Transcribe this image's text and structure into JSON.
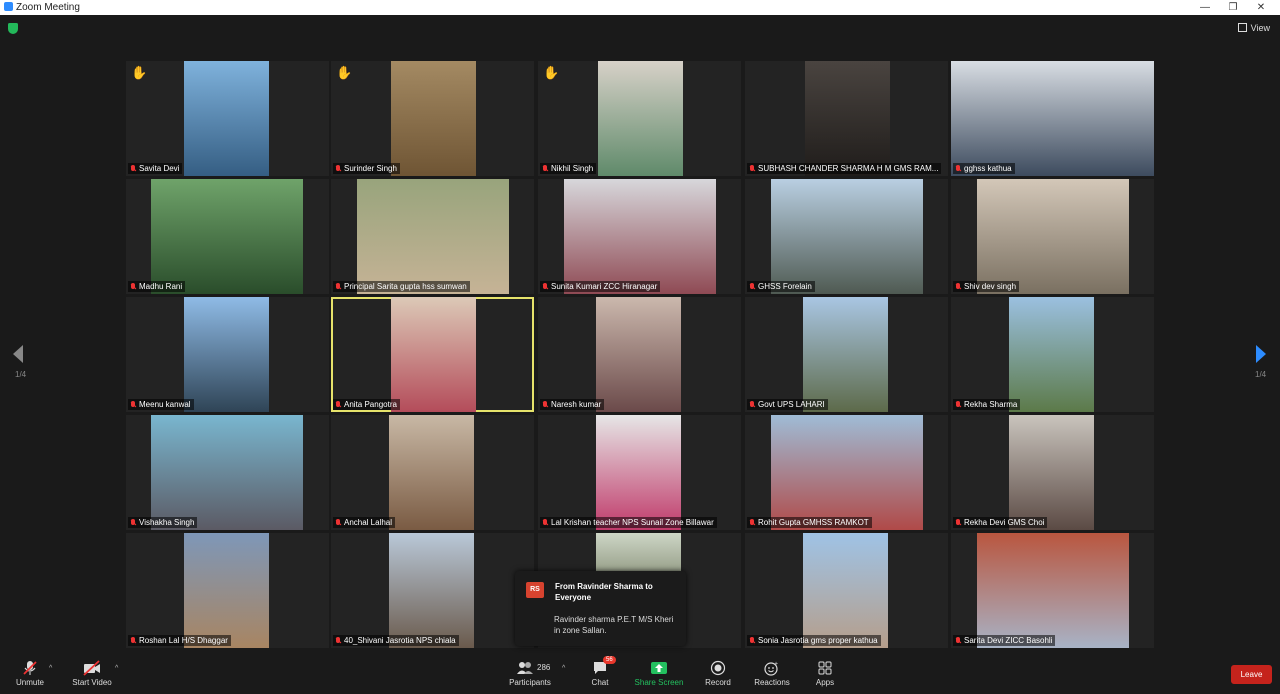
{
  "window": {
    "title": "Zoom Meeting"
  },
  "topbar": {
    "view_label": "View"
  },
  "nav": {
    "page_left": "1/4",
    "page_right": "1/4"
  },
  "tiles": [
    {
      "name": "Savita Devi",
      "hand": "✋"
    },
    {
      "name": "Surinder Singh",
      "hand": "✋"
    },
    {
      "name": "Nikhil Singh",
      "hand": "✋"
    },
    {
      "name": "SUBHASH CHANDER SHARMA H M GMS RAM..."
    },
    {
      "name": "gghss kathua"
    },
    {
      "name": "Madhu Rani"
    },
    {
      "name": "Principal Sarita gupta hss sumwan"
    },
    {
      "name": "Sunita Kumari ZCC Hiranagar"
    },
    {
      "name": "GHSS Forelain"
    },
    {
      "name": "Shiv dev singh"
    },
    {
      "name": "Meenu kanwal"
    },
    {
      "name": "Anita Pangotra",
      "active": true
    },
    {
      "name": "Naresh kumar"
    },
    {
      "name": "Govt UPS LAHARI"
    },
    {
      "name": "Rekha Sharma"
    },
    {
      "name": "Vishakha Singh"
    },
    {
      "name": "Anchal Lalhal"
    },
    {
      "name": "Lal Krishan teacher NPS Sunail Zone Billawar"
    },
    {
      "name": "Rohit Gupta GMHSS RAMKOT"
    },
    {
      "name": "Rekha Devi GMS Choi"
    },
    {
      "name": "Roshan Lal H/S Dhaggar"
    },
    {
      "name": "40_Shivani Jasrotia NPS chiala"
    },
    {
      "name": ""
    },
    {
      "name": "Sonia Jasrotia gms proper kathua"
    },
    {
      "name": "Sarita Devi ZICC Basohli"
    }
  ],
  "chat_popup": {
    "avatar": "RS",
    "from": "From Ravinder Sharma to Everyone",
    "message": "Ravinder sharma P.E.T M/S Kheri in zone Sallan."
  },
  "toolbar": {
    "unmute": "Unmute",
    "start_video": "Start Video",
    "participants": "Participants",
    "participants_count": "286",
    "chat": "Chat",
    "chat_badge": "56",
    "share_screen": "Share Screen",
    "record": "Record",
    "reactions": "Reactions",
    "apps": "Apps",
    "leave": "Leave"
  },
  "colors": {
    "background": "#1a1a1a",
    "active_speaker": "#e6e36b",
    "share_screen": "#23c05f",
    "leave": "#c5231c",
    "muted": "#e33333",
    "nav_arrow": "#2d8cff"
  }
}
